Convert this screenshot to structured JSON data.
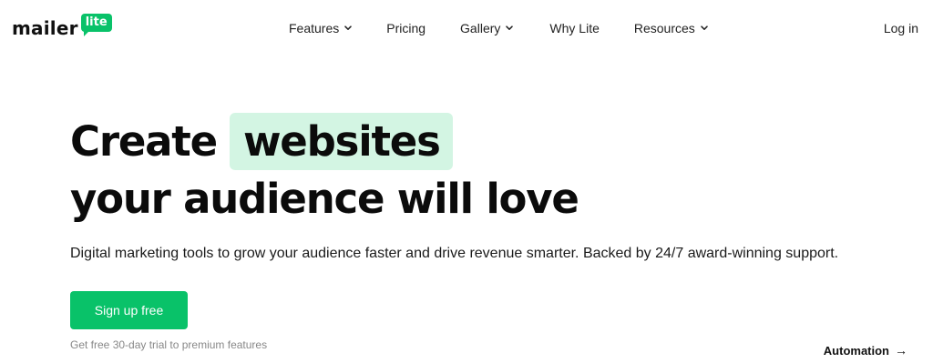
{
  "logo": {
    "word": "mailer",
    "badge": "lite"
  },
  "nav": {
    "items": [
      {
        "label": "Features",
        "has_dropdown": true
      },
      {
        "label": "Pricing",
        "has_dropdown": false
      },
      {
        "label": "Gallery",
        "has_dropdown": true
      },
      {
        "label": "Why Lite",
        "has_dropdown": false
      },
      {
        "label": "Resources",
        "has_dropdown": true
      }
    ],
    "login": "Log in"
  },
  "hero": {
    "title_prefix": "Create",
    "title_highlight": "websites",
    "title_line2": "your audience will love",
    "subtitle": "Digital marketing tools to grow your audience faster and drive revenue smarter. Backed by 24/7 award-winning support.",
    "cta_label": "Sign up free",
    "trial_note": "Get free 30-day trial to premium features",
    "secondary_link": "Automation",
    "secondary_arrow": "→"
  },
  "colors": {
    "brand_green": "#09c269",
    "highlight_bg": "#d3f5e3",
    "text_dark": "#0b0b0b",
    "muted": "#888888"
  },
  "icons": {
    "dropdown": "chevron-down-icon",
    "secondary_link": "arrow-right-icon"
  }
}
